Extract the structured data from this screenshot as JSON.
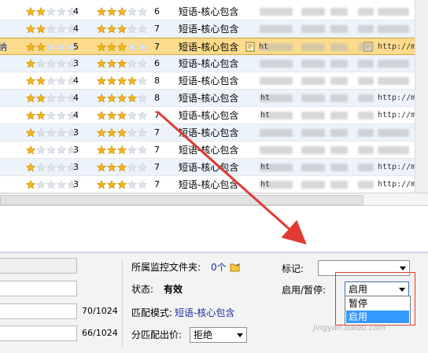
{
  "grid": {
    "type_label": "短语-核心包含",
    "url_prefix": "http://m",
    "url_prefix_short": "ht",
    "rows": [
      {
        "left_label": "",
        "rating1": 4,
        "stars1_filled": 2,
        "rating2": 6,
        "stars2_filled": 3,
        "note_icon": false,
        "has_url": false
      },
      {
        "left_label": "",
        "rating1": 4,
        "stars1_filled": 2,
        "rating2": 7,
        "stars2_filled": 3,
        "note_icon": false,
        "has_url": false
      },
      {
        "left_label": "纳",
        "rating1": 5,
        "stars1_filled": 2,
        "rating2": 7,
        "stars2_filled": 3,
        "note_icon": true,
        "has_url": true,
        "selected": true
      },
      {
        "left_label": "",
        "rating1": 3,
        "stars1_filled": 1,
        "rating2": 6,
        "stars2_filled": 3,
        "note_icon": false,
        "has_url": false
      },
      {
        "left_label": "",
        "rating1": 4,
        "stars1_filled": 2,
        "rating2": 8,
        "stars2_filled": 4,
        "note_icon": false,
        "has_url": false
      },
      {
        "left_label": "",
        "rating1": 4,
        "stars1_filled": 2,
        "rating2": 8,
        "stars2_filled": 4,
        "note_icon": false,
        "has_url": true
      },
      {
        "left_label": "",
        "rating1": 4,
        "stars1_filled": 2,
        "rating2": 7,
        "stars2_filled": 3,
        "note_icon": false,
        "has_url": true
      },
      {
        "left_label": "",
        "rating1": 3,
        "stars1_filled": 1,
        "rating2": 7,
        "stars2_filled": 3,
        "note_icon": false,
        "has_url": false
      },
      {
        "left_label": "",
        "rating1": 3,
        "stars1_filled": 1,
        "rating2": 7,
        "stars2_filled": 3,
        "note_icon": false,
        "has_url": false
      },
      {
        "left_label": "",
        "rating1": 3,
        "stars1_filled": 1,
        "rating2": 7,
        "stars2_filled": 3,
        "note_icon": false,
        "has_url": true
      },
      {
        "left_label": "",
        "rating1": 3,
        "stars1_filled": 1,
        "rating2": 7,
        "stars2_filled": 3,
        "note_icon": false,
        "has_url": true
      }
    ]
  },
  "panel": {
    "folder_label": "所属监控文件夹:",
    "folder_value": "0个",
    "status_label": "状态:",
    "status_value": "有效",
    "match_label": "匹配模式:",
    "match_value": "短语-核心包含",
    "bid_label": "分匹配出价:",
    "bid_value": "拒绝",
    "mark_label": "标记:",
    "mark_value": "",
    "toggle_label": "启用/暂停:",
    "toggle_value": "启用",
    "counter1": "70/1024",
    "counter2": "66/1024",
    "dropdown_options": [
      "暂停",
      "启用"
    ],
    "dropdown_highlighted": "启用"
  },
  "colors": {
    "selected_row": "#fcdb8c",
    "star_filled": "#f2b51d",
    "star_empty": "#dfe3ea",
    "link": "#1a2f9c",
    "highlight": "#3399ff",
    "annotation": "#e03a32"
  },
  "watermark": "jingyan.baidu.com"
}
